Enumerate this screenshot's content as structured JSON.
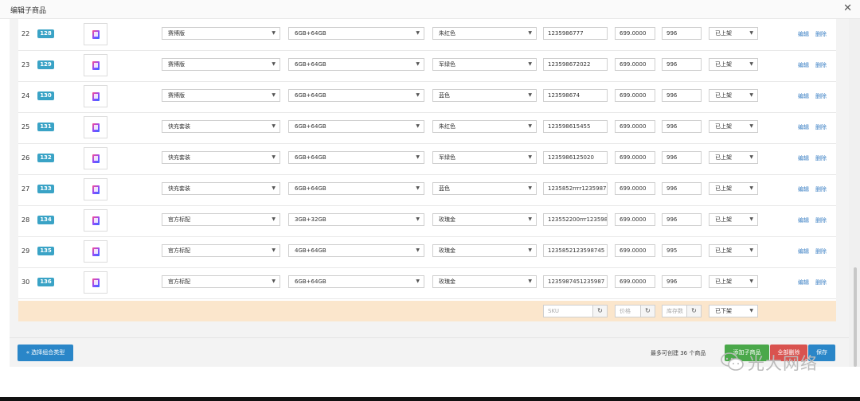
{
  "dialog": {
    "title": "编辑子商品"
  },
  "rows": [
    {
      "index": "22",
      "badge": "128",
      "variant": "赛博版",
      "storage": "6GB+64GB",
      "color": "朱红色",
      "sku": "1235986777",
      "price": "699.0000",
      "stock": "996",
      "status": "已上架",
      "edit": "编辑",
      "delete": "删除"
    },
    {
      "index": "23",
      "badge": "129",
      "variant": "赛博版",
      "storage": "6GB+64GB",
      "color": "军绿色",
      "sku": "123598672022",
      "price": "699.0000",
      "stock": "996",
      "status": "已上架",
      "edit": "编辑",
      "delete": "删除"
    },
    {
      "index": "24",
      "badge": "130",
      "variant": "赛博版",
      "storage": "6GB+64GB",
      "color": "蓝色",
      "sku": "123598674",
      "price": "699.0000",
      "stock": "996",
      "status": "已上架",
      "edit": "编辑",
      "delete": "删除"
    },
    {
      "index": "25",
      "badge": "131",
      "variant": "快充套装",
      "storage": "6GB+64GB",
      "color": "朱红色",
      "sku": "123598615455",
      "price": "699.0000",
      "stock": "996",
      "status": "已上架",
      "edit": "编辑",
      "delete": "删除"
    },
    {
      "index": "26",
      "badge": "132",
      "variant": "快充套装",
      "storage": "6GB+64GB",
      "color": "军绿色",
      "sku": "1235986125020",
      "price": "699.0000",
      "stock": "996",
      "status": "已上架",
      "edit": "编辑",
      "delete": "删除"
    },
    {
      "index": "27",
      "badge": "133",
      "variant": "快充套装",
      "storage": "6GB+64GB",
      "color": "蓝色",
      "sku": "1235852rrrr1235987",
      "price": "699.0000",
      "stock": "996",
      "status": "已上架",
      "edit": "编辑",
      "delete": "删除"
    },
    {
      "index": "28",
      "badge": "134",
      "variant": "官方标配",
      "storage": "3GB+32GB",
      "color": "玫瑰金",
      "sku": "123552200rrr123598",
      "price": "699.0000",
      "stock": "996",
      "status": "已上架",
      "edit": "编辑",
      "delete": "删除"
    },
    {
      "index": "29",
      "badge": "135",
      "variant": "官方标配",
      "storage": "4GB+64GB",
      "color": "玫瑰金",
      "sku": "1235852123598745",
      "price": "699.0000",
      "stock": "995",
      "status": "已上架",
      "edit": "编辑",
      "delete": "删除"
    },
    {
      "index": "30",
      "badge": "136",
      "variant": "官方标配",
      "storage": "6GB+64GB",
      "color": "玫瑰金",
      "sku": "1235987451235987",
      "price": "699.0000",
      "stock": "996",
      "status": "已上架",
      "edit": "编辑",
      "delete": "删除"
    }
  ],
  "batch": {
    "sku_placeholder": "SKU",
    "price_placeholder": "价格",
    "stock_placeholder": "库存数",
    "status": "已下架",
    "refresh_glyph": "↻"
  },
  "footer": {
    "back_label": "« 选择组合类型",
    "limit_text": "最多可创建 36 个商品",
    "add_label": "添加子商品",
    "delete_all_label": "全部删除",
    "save_label": "保存"
  },
  "watermark": {
    "text": "光大网络"
  },
  "icons": {
    "close": "close-icon",
    "dropdown": "chevron-down-icon",
    "refresh": "refresh-icon",
    "wechat": "wechat-logo-icon"
  },
  "colors": {
    "badge": "#3aa3c6",
    "link": "#3a7fc4",
    "batch_bg": "#fbe6cc",
    "primary": "#2a86c8",
    "success": "#4aa84a",
    "danger": "#d9534f"
  }
}
